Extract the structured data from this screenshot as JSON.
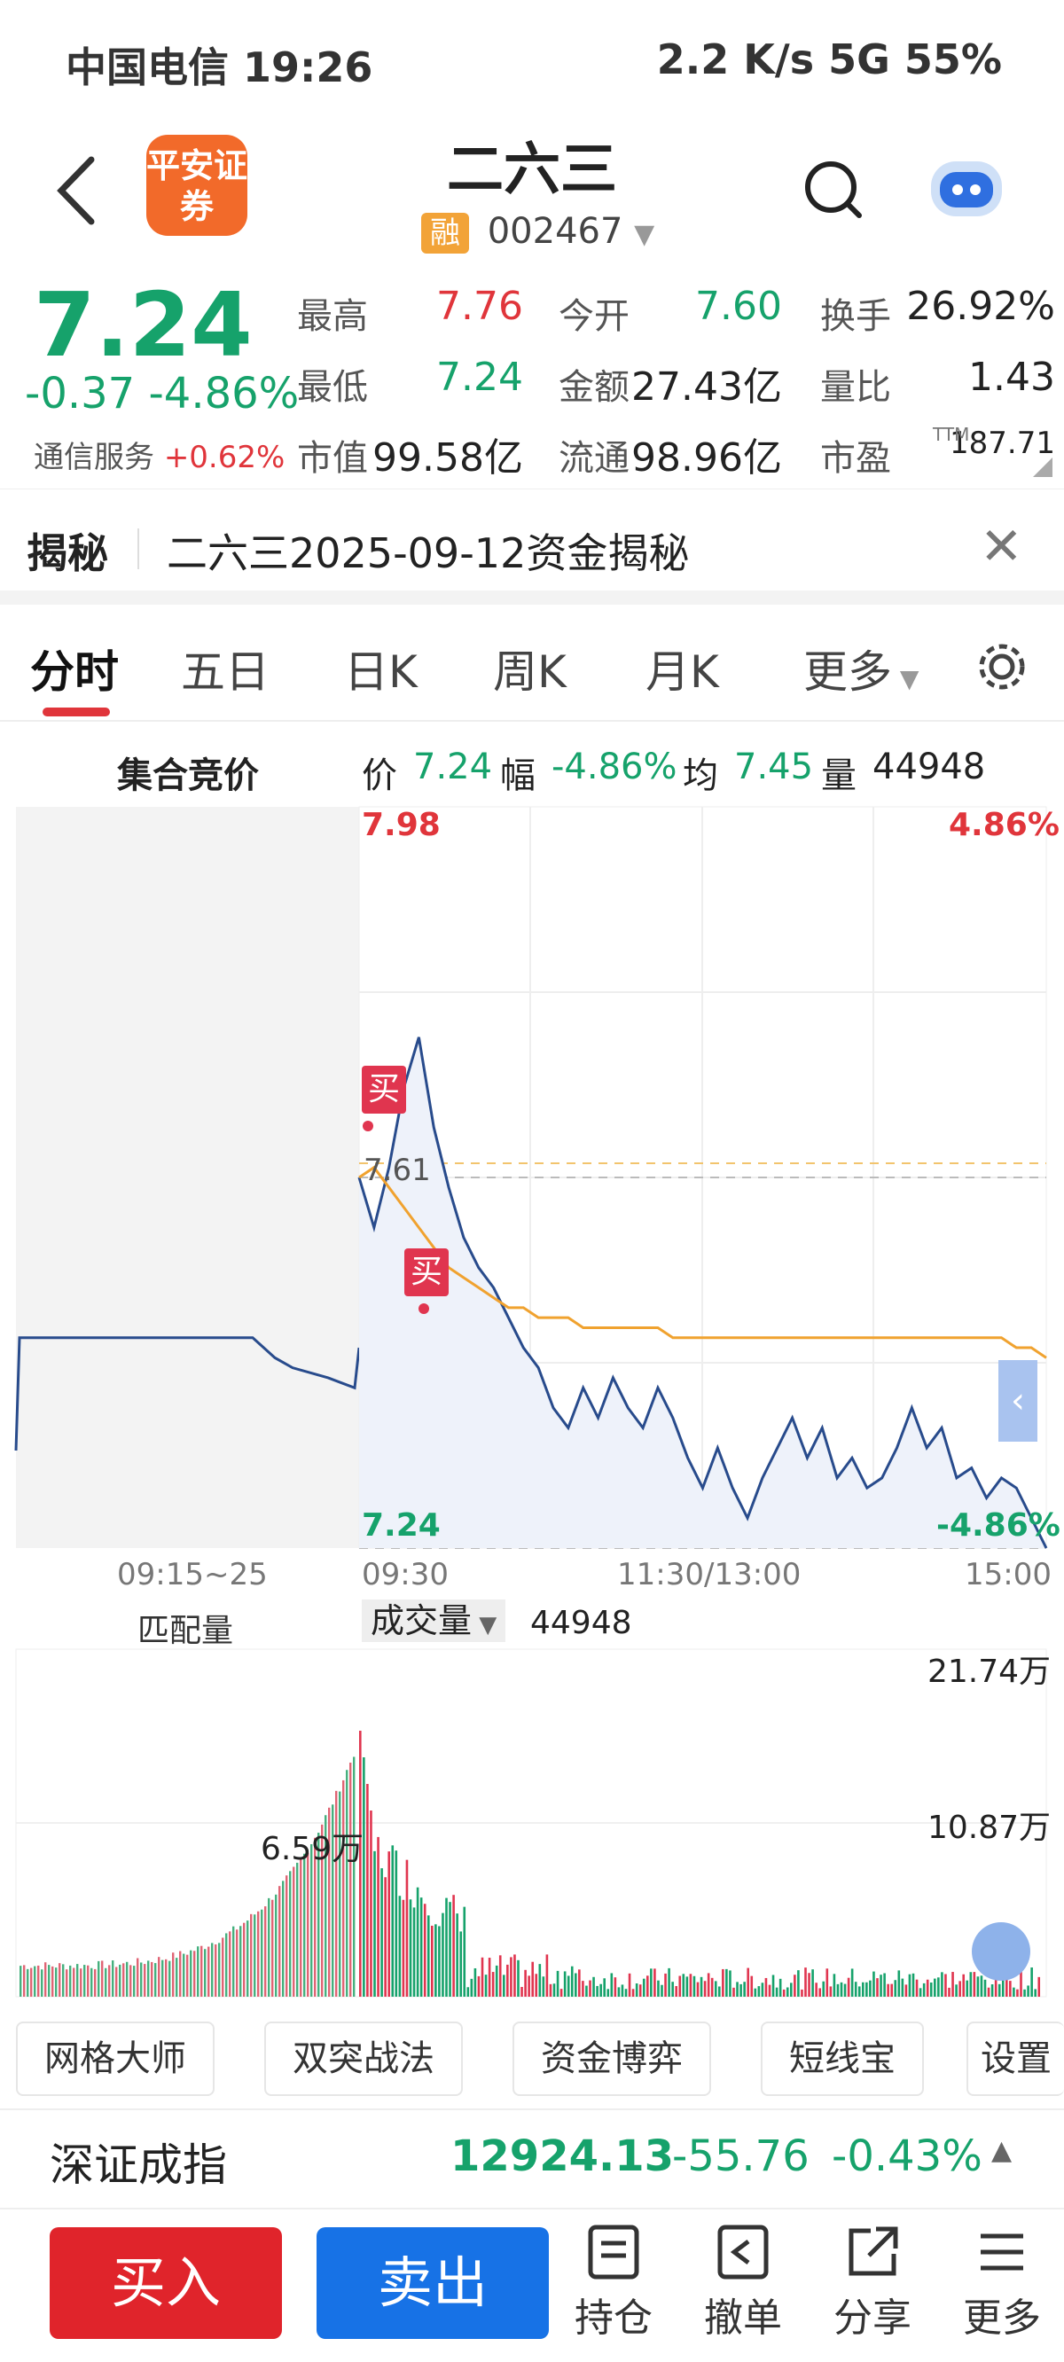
{
  "status_bar": {
    "carrier_time": "中国电信 19:26",
    "right": "2.2 K/s 5G 55%"
  },
  "header": {
    "logo_text": "平安证券",
    "title": "二六三",
    "badge": "融",
    "code": "002467"
  },
  "quote": {
    "price": "7.24",
    "change": "-0.37",
    "change_pct": "-4.86%",
    "industry": "通信服务",
    "industry_pct": "+0.62%",
    "fields": [
      {
        "k": "最高",
        "v": "7.76",
        "c": "red"
      },
      {
        "k": "今开",
        "v": "7.60",
        "c": "green"
      },
      {
        "k": "换手",
        "v": "26.92%",
        "c": "black"
      },
      {
        "k": "最低",
        "v": "7.24",
        "c": "green"
      },
      {
        "k": "金额",
        "v": "27.43亿",
        "c": "black"
      },
      {
        "k": "量比",
        "v": "1.43",
        "c": "black"
      },
      {
        "k": "市值",
        "v": "99.58亿",
        "c": "black"
      },
      {
        "k": "流通",
        "v": "98.96亿",
        "c": "black"
      },
      {
        "k": "市盈",
        "v": "187.71",
        "c": "black"
      }
    ],
    "ttm": "TTM"
  },
  "reveal": {
    "heading": "揭秘",
    "text": "二六三2025-09-12资金揭秘",
    "close": "✕"
  },
  "tabs": [
    "分时",
    "五日",
    "日K",
    "周K",
    "月K",
    "更多"
  ],
  "info_row": {
    "auction": "集合竞价",
    "price_k": "价",
    "price_v": "7.24",
    "range_k": "幅",
    "range_v": "-4.86%",
    "avg_k": "均",
    "avg_v": "7.45",
    "vol_k": "量",
    "vol_v": "44948"
  },
  "chart_labels": {
    "high_price": "7.98",
    "high_pct": "4.86%",
    "prev_close": "7.61",
    "low_price": "7.24",
    "low_pct": "-4.86%",
    "t_auction": "09:15~25",
    "t_open": "09:30",
    "t_mid": "11:30/13:00",
    "t_close": "15:00",
    "match_vol": "匹配量",
    "vol_label": "成交量",
    "vol_value": "44948",
    "vol_max": "21.74万",
    "vol_mid": "10.87万",
    "vol_peak": "6.59万",
    "buy_marker": "买"
  },
  "tools": [
    "网格大师",
    "双突战法",
    "资金博弈",
    "短线宝",
    "设置"
  ],
  "index": {
    "name": "深证成指",
    "value": "12924.13",
    "change": "-55.76",
    "pct": "-0.43%"
  },
  "bottom": {
    "buy": "买入",
    "sell": "卖出",
    "icons": [
      "持仓",
      "撤单",
      "分享",
      "更多"
    ]
  },
  "chart_data": {
    "type": "line",
    "ylim": [
      7.24,
      7.98
    ],
    "series": [
      {
        "values": [
          7.61,
          7.56,
          7.62,
          7.7,
          7.75,
          7.66,
          7.6,
          7.55,
          7.52,
          7.5,
          7.47,
          7.44,
          7.42,
          7.38,
          7.36,
          7.4,
          7.37,
          7.41,
          7.38,
          7.36,
          7.4,
          7.37,
          7.33,
          7.3,
          7.34,
          7.3,
          7.27,
          7.31,
          7.34,
          7.37,
          7.33,
          7.36,
          7.31,
          7.33,
          7.3,
          7.31,
          7.34,
          7.38,
          7.34,
          7.36,
          7.31,
          7.32,
          7.29,
          7.31,
          7.3,
          7.27,
          7.24
        ]
      },
      {
        "values": [
          7.61,
          7.62,
          7.6,
          7.58,
          7.56,
          7.54,
          7.52,
          7.51,
          7.5,
          7.49,
          7.48,
          7.48,
          7.47,
          7.47,
          7.47,
          7.46,
          7.46,
          7.46,
          7.46,
          7.46,
          7.46,
          7.45,
          7.45,
          7.45,
          7.45,
          7.45,
          7.45,
          7.45,
          7.45,
          7.45,
          7.45,
          7.45,
          7.45,
          7.45,
          7.45,
          7.45,
          7.45,
          7.45,
          7.45,
          7.45,
          7.45,
          7.45,
          7.45,
          7.45,
          7.44,
          7.44,
          7.43
        ]
      }
    ]
  }
}
